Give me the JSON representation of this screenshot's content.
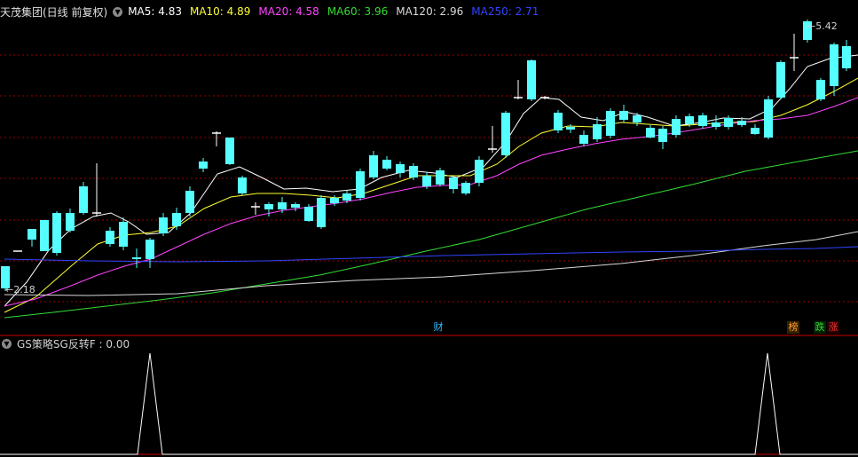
{
  "header": {
    "title": "天茂集团(日线 前复权)",
    "ma": [
      {
        "label": "MA5: 4.83",
        "color": "#ffffff"
      },
      {
        "label": "MA10: 4.89",
        "color": "#ffff33"
      },
      {
        "label": "MA20: 4.58",
        "color": "#ff44ff"
      },
      {
        "label": "MA60: 3.96",
        "color": "#33dd33"
      },
      {
        "label": "MA120: 2.96",
        "color": "#d8d8d8"
      },
      {
        "label": "MA250: 2.71",
        "color": "#3344ff"
      }
    ]
  },
  "annotations": {
    "high_label": "5.42",
    "low_label": "2.18"
  },
  "tags": {
    "finance": "财",
    "rank": "榜",
    "drop": "跌",
    "rise": "涨"
  },
  "indicator": {
    "title": "GS策略SG反转F : 0.00"
  },
  "colors": {
    "up": "#ff3333",
    "down": "#55ffff",
    "grid": "#990000"
  }
}
